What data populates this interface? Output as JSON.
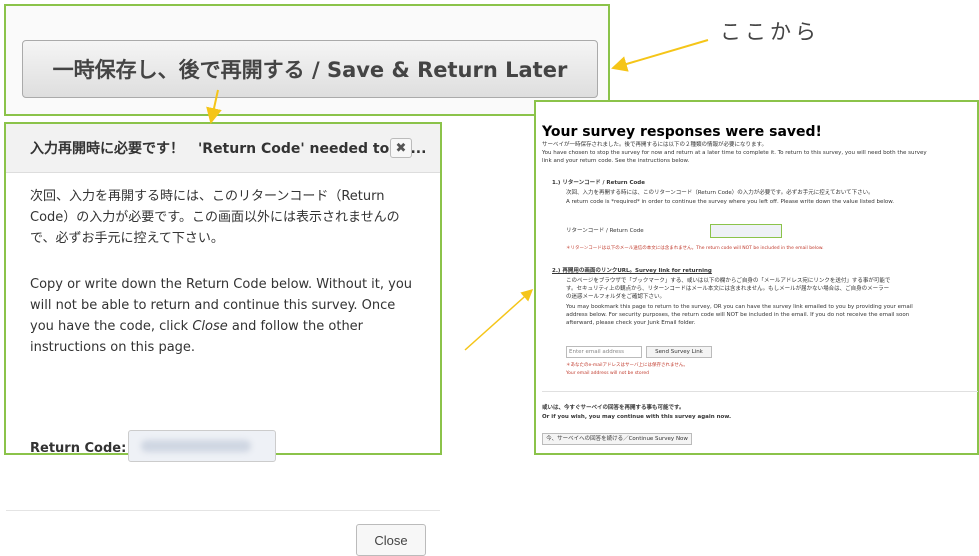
{
  "save_button": {
    "label": "一時保存し、後で再開する / Save & Return Later"
  },
  "annotation": {
    "text": "ここから"
  },
  "modal": {
    "title": "入力再開時に必要です！　'Return Code' needed to re...",
    "close_x": "✖",
    "para1": "次回、入力を再開する時には、このリターンコード（Return Code）の入力が必要です。この画面以外には表示されませんので、必ずお手元に控えて下さい。",
    "para2_a": "Copy or write down the Return Code below. Without it, you will not be able to return and continue this survey. Once you have the code, click ",
    "para2_close": "Close",
    "para2_b": " and follow the other instructions on this page.",
    "return_code_label": "Return Code:",
    "close_button": "Close"
  },
  "saved_page": {
    "title": "Your survey responses were saved!",
    "intro_jp": "サーベイが一時保存されました。後で再開するには以下の２種類の情報が必要になります。",
    "intro_en1": "You have chosen to stop the survey for now and return at a later time to complete it. To return to this survey, you will need both the survey",
    "intro_en2": "link and your return code. See the instructions below.",
    "s1_title": "1.) リターンコード / Return Code",
    "s1_jp": "次回、入力を再開する時には、このリターンコード（Return Code）の入力が必要です。必ずお手元に控えておいて下さい。",
    "s1_en": "A return code is *required* in order to continue the survey where you left off. Please write down the value listed below.",
    "s1_label": "リターンコード / Return Code",
    "s1_note": "＊リターンコードは以下のメール送信の本文には含まれません。The return code will NOT be included in the email below.",
    "s2_title": "2.) 再開用の画面のリンクURL。Survey link for returning",
    "s2_jp1": "このページをブラウザで「ブックマーク」する、或いは以下の欄からご自身の「メールアドレス宛にリンクを送付」する事が可能で",
    "s2_jp2": "す。セキュリティ上の観点から、リターンコードはメール本文には含まれません。もしメールが届かない場合は、ご自身のメーラー",
    "s2_jp3": "の迷惑メールフォルダをご確認下さい。",
    "s2_en1": "You may bookmark this page to return to the survey, OR you can have the survey link emailed to you by providing your email",
    "s2_en2": "address below. For security purposes, the return code will NOT be included in the email. If you do not receive the email soon",
    "s2_en3": "afterward, please check your Junk Email folder.",
    "email_placeholder": "Enter email address",
    "send_button": "Send Survey Link",
    "email_note_jp": "＊あなたのe-mailアドレスはサーバ上には保存されません。",
    "email_note_en": "Your email address will not be stored",
    "continue_jp": "或いは、今すぐサーベイの回答を再開する事も可能です。",
    "continue_en": "Or if you wish, you may continue with this survey again now.",
    "continue_button": "今、サーベイへの回答を続ける／Continue Survey Now"
  },
  "colors": {
    "highlight_border": "#8bc34a",
    "arrow": "#f5c518"
  }
}
